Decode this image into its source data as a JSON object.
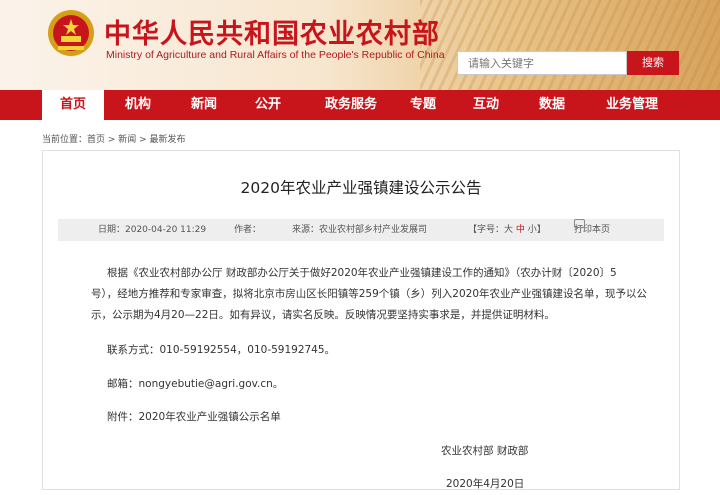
{
  "header": {
    "title": "中华人民共和国农业农村部",
    "subtitle": "Ministry of Agriculture and Rural Affairs of the People's Republic of China",
    "search_placeholder": "请输入关键字",
    "search_button": "搜索"
  },
  "nav": {
    "items": [
      {
        "label": "首页",
        "active": true
      },
      {
        "label": "机构"
      },
      {
        "label": "新闻"
      },
      {
        "label": "公开"
      },
      {
        "label": "政务服务"
      },
      {
        "label": "专题"
      },
      {
        "label": "互动"
      },
      {
        "label": "数据"
      },
      {
        "label": "业务管理"
      }
    ]
  },
  "breadcrumb": "当前位置：首页 > 新闻 > 最新发布",
  "article": {
    "title": "2020年农业产业强镇建设公示公告",
    "date": "日期：2020-04-20 11:29",
    "author": "作者：",
    "source": "来源：农业农村部乡村产业发展司",
    "font_size_label": "【字号：",
    "font_big": "大",
    "font_mid": "中",
    "font_small": "小",
    "font_close": "】",
    "print": "打印本页",
    "para1_line1": "根据《农业农村部办公厅 财政部办公厅关于做好2020年农业产业强镇建设工作的通知》（农办计财〔2020〕5",
    "para1_line2": "号），经地方推荐和专家审查，拟将北京市房山区长阳镇等259个镇（乡）列入2020年农业产业强镇建设名单，现予以公",
    "para1_line3": "示，公示期为4月20—22日。如有异议，请实名反映。反映情况要坚持实事求是，并提供证明材料。",
    "contact": "联系方式：010-59192554，010-59192745。",
    "email": "邮箱：nongyebutie@agri.gov.cn。",
    "attachment": "附件：2020年农业产业强镇公示名单",
    "signature": "农业农村部 财政部",
    "sign_date": "2020年4月20日"
  }
}
